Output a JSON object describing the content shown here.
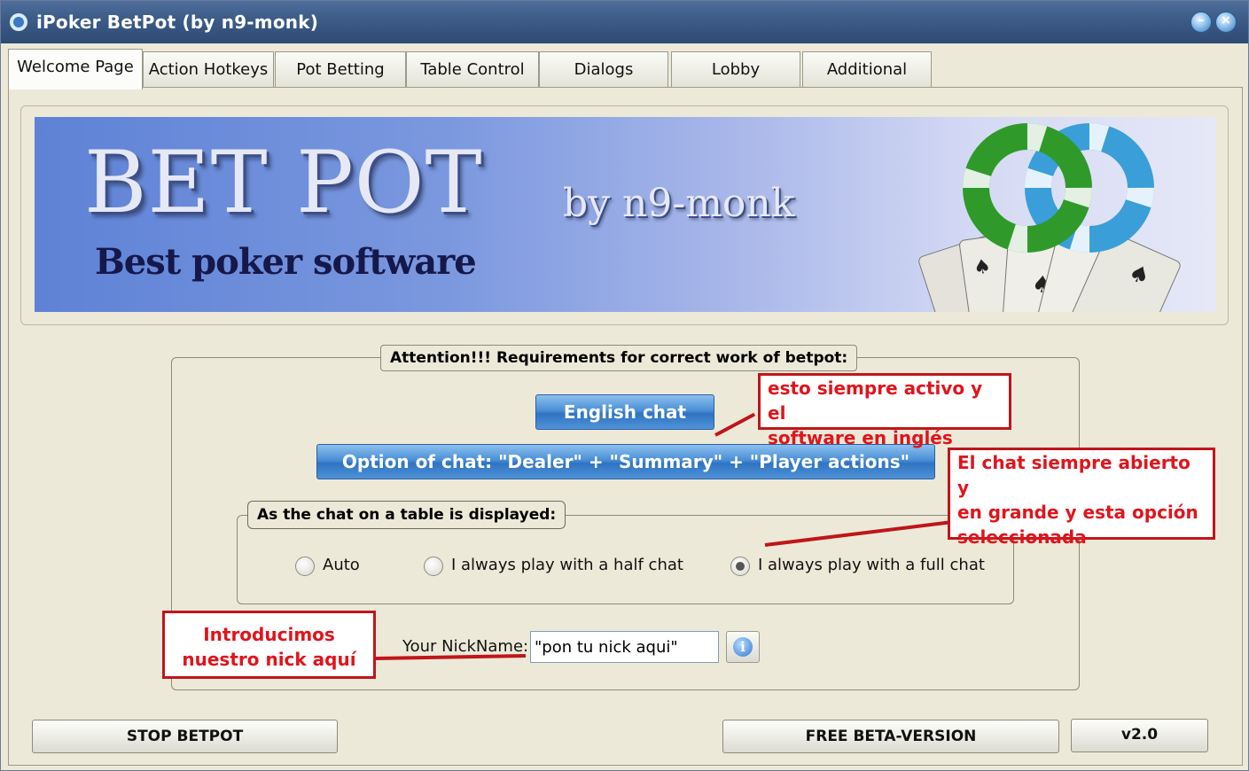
{
  "window": {
    "title": "iPoker BetPot (by n9-monk)"
  },
  "tabs": [
    {
      "label": "Welcome Page",
      "active": true
    },
    {
      "label": "Action Hotkeys"
    },
    {
      "label": "Pot Betting"
    },
    {
      "label": "Table Control"
    },
    {
      "label": "Dialogs"
    },
    {
      "label": "Lobby"
    },
    {
      "label": "Additional"
    }
  ],
  "banner": {
    "title": "BET POT",
    "byline": "by n9-monk",
    "tagline": "Best poker software",
    "logo_icon": "lifebuoy-cards-logo"
  },
  "requirements": {
    "legend": "Attention!!! Requirements for correct work of betpot:",
    "english_chat_button": "English chat",
    "option_chat_button": "Option of chat: \"Dealer\" + \"Summary\" + \"Player actions\"",
    "chat_display": {
      "legend": "As the chat on a table is displayed:",
      "options": [
        {
          "label": "Auto",
          "selected": false
        },
        {
          "label": "I always play with a half chat",
          "selected": false
        },
        {
          "label": "I always play with a full chat",
          "selected": true
        }
      ]
    },
    "nickname": {
      "label": "Your NickName:",
      "value": "\"pon tu nick aqui\""
    }
  },
  "footer": {
    "stop_button": "STOP BETPOT",
    "beta_button": "FREE BETA-VERSION",
    "version_button": "v2.0"
  },
  "annotations": {
    "note1_line1": "esto siempre activo y el",
    "note1_line2": "software en inglés",
    "note2_line1": "El chat siempre abierto y",
    "note2_line2": "en grande y esta opción",
    "note2_line3": "seleccionada",
    "note3_line1": "Introducimos",
    "note3_line2": "nuestro nick aquí"
  },
  "colors": {
    "annotation_red": "#e0141c",
    "accent_blue": "#2f73c2"
  }
}
